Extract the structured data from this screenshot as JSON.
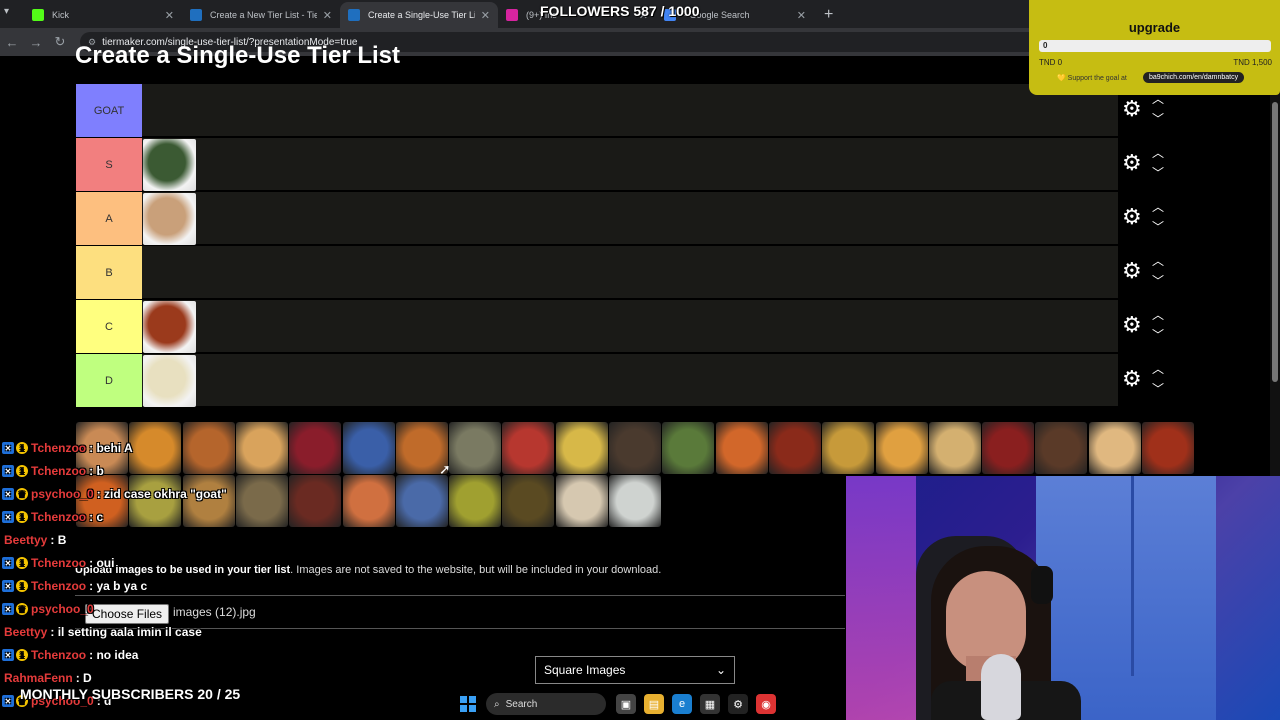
{
  "browser": {
    "tabs": [
      {
        "label": "Kick",
        "color": "#53fc18",
        "active": false
      },
      {
        "label": "Create a New Tier List - TierMak",
        "color": "#1f6fbf",
        "active": false
      },
      {
        "label": "Create a Single-Use Tier List (P",
        "color": "#1f6fbf",
        "active": true
      },
      {
        "label": "(9+) Ins",
        "color": "#d6249f",
        "active": false
      },
      {
        "label": "- Google Search",
        "color": "#4285f4",
        "active": false
      }
    ],
    "url": "tiermaker.com/single-use-tier-list/?presentationMode=true",
    "new_tab_glyph": "+"
  },
  "page": {
    "title": "Create a Single-Use Tier List",
    "tiers": [
      {
        "label": "GOAT",
        "color": "#7f7ffe",
        "items": []
      },
      {
        "label": "S",
        "color": "#f27f7f",
        "items": [
          "#3b5a33"
        ]
      },
      {
        "label": "A",
        "color": "#fdbf7f",
        "items": [
          "#c9a07a"
        ]
      },
      {
        "label": "B",
        "color": "#fddf7f",
        "items": []
      },
      {
        "label": "C",
        "color": "#ffff7f",
        "items": [
          "#9b3a1c"
        ]
      },
      {
        "label": "D",
        "color": "#bfff7f",
        "items": [
          "#e8e0c0"
        ]
      }
    ],
    "pool_colors": [
      "#c98a55",
      "#d68a2b",
      "#b5652c",
      "#d9a35c",
      "#8a1d2b",
      "#3a5fa8",
      "#c06b2a",
      "#7a7a62",
      "#b7372f",
      "#d7b848",
      "#4a3a2e",
      "#5a7a3a",
      "#d2672a",
      "#8a2a1a",
      "#c79a3a",
      "#e0a040",
      "#d4b070",
      "#8a1f1f",
      "#5a3a28",
      "#e0b880",
      "#a0301a",
      "#d06020",
      "#a8a040",
      "#b08040",
      "#7a6a4a",
      "#6a2a22",
      "#d07040",
      "#4a6aa8",
      "#a0a030",
      "#5a4a22",
      "#d6c8b0",
      "#cfd3d0"
    ],
    "upload_text_bold": "Upload images to be used in your tier list",
    "upload_text_rest": ". Images are not saved to the website, but will be included in your download.",
    "choose_files": "Choose Files",
    "file_name": "images (12).jpg",
    "select_value": "Square Images"
  },
  "overlay": {
    "followers": "FOLLOWERS 587 / 1000",
    "upgrade": {
      "title": "upgrade",
      "progress": 0,
      "progress_label": "0",
      "min": "TND 0",
      "max": "TND 1,500",
      "support": "Support the goal at",
      "link": "ba9chich.com/en/damnbatcy"
    },
    "chat": [
      {
        "badges": true,
        "sub": false,
        "user": "Tchenzoo",
        "color": "#e53b3b",
        "msg": ": behi A"
      },
      {
        "badges": true,
        "sub": false,
        "user": "Tchenzoo",
        "color": "#e53b3b",
        "msg": ": b"
      },
      {
        "badges": true,
        "sub": true,
        "user": "psychoo_0",
        "color": "#e53b3b",
        "msg": ": zid case okhra \"goat\""
      },
      {
        "badges": true,
        "sub": false,
        "user": "Tchenzoo",
        "color": "#e53b3b",
        "msg": ": c"
      },
      {
        "badges": false,
        "sub": false,
        "user": "Beettyy",
        "color": "#e53b3b",
        "msg": ": B"
      },
      {
        "badges": true,
        "sub": false,
        "user": "Tchenzoo",
        "color": "#e53b3b",
        "msg": ": oui"
      },
      {
        "badges": true,
        "sub": false,
        "user": "Tchenzoo",
        "color": "#e53b3b",
        "msg": ": ya b ya c"
      },
      {
        "badges": true,
        "sub": true,
        "user": "psychoo_0",
        "color": "#e53b3b",
        "msg": ""
      },
      {
        "badges": false,
        "sub": false,
        "user": "Beettyy",
        "color": "#e53b3b",
        "msg": ": il setting aala imin il case"
      },
      {
        "badges": true,
        "sub": false,
        "user": "Tchenzoo",
        "color": "#e53b3b",
        "msg": ": no idea"
      },
      {
        "badges": false,
        "sub": false,
        "user": "RahmaFenn",
        "color": "#e53b3b",
        "msg": ": D"
      },
      {
        "badges": true,
        "sub": true,
        "user": "psychoo_0",
        "color": "#e53b3b",
        "msg": ": d"
      }
    ],
    "monthly": "MONTHLY SUBSCRIBERS 20 / 25"
  },
  "taskbar": {
    "search": "Search"
  }
}
